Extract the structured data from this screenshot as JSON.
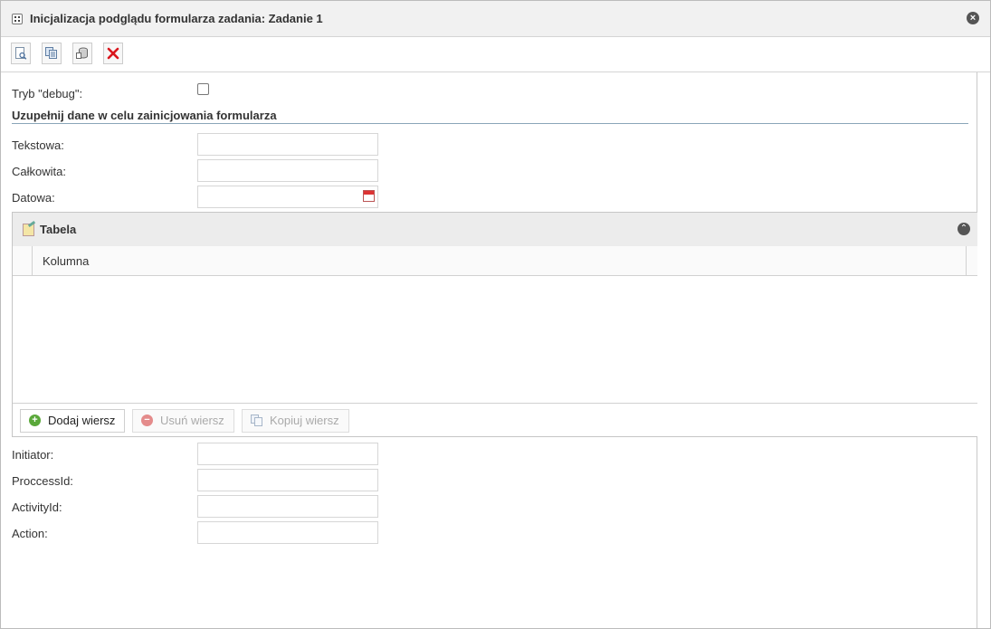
{
  "window": {
    "title": "Inicjalizacja podglądu formularza zadania: Zadanie 1",
    "close_glyph": "×"
  },
  "toolbar": {
    "buttons": [
      {
        "name": "preview-icon"
      },
      {
        "name": "copy-icon"
      },
      {
        "name": "database-icon"
      },
      {
        "name": "delete-icon",
        "color": "#d9161d"
      }
    ]
  },
  "form": {
    "debug_label": "Tryb \"debug\":",
    "debug_checked": false,
    "section_title": "Uzupełnij dane w celu zainicjowania formularza",
    "fields_top": [
      {
        "label": "Tekstowa:",
        "value": ""
      },
      {
        "label": "Całkowita:",
        "value": ""
      },
      {
        "label": "Datowa:",
        "value": ""
      }
    ],
    "fields_bottom": [
      {
        "label": "Initiator:",
        "value": ""
      },
      {
        "label": "ProccessId:",
        "value": ""
      },
      {
        "label": "ActivityId:",
        "value": ""
      },
      {
        "label": "Action:",
        "value": ""
      }
    ]
  },
  "table_panel": {
    "title": "Tabela",
    "column_header": "Kolumna",
    "collapse_glyph": "⌃",
    "add_label": "Dodaj wiersz",
    "remove_label": "Usuń wiersz",
    "copy_label": "Kopiuj wiersz",
    "add_glyph": "+",
    "remove_glyph": "−",
    "add_color": "#5aa83a",
    "remove_color": "#e48b8b"
  }
}
